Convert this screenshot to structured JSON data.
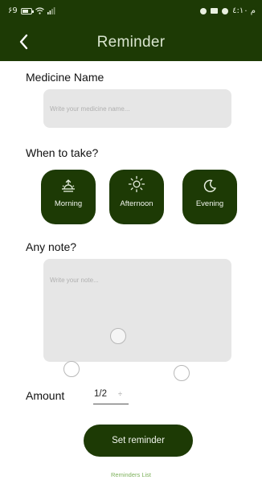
{
  "status_bar": {
    "left_text": "۶9",
    "right_text": "م ٤:١٠",
    "icons": [
      "battery-icon",
      "wifi-icon",
      "signal-icon",
      "whatsapp-icon",
      "camera-icon",
      "whatsapp-icon"
    ]
  },
  "header": {
    "title": "Reminder",
    "back_icon": "chevron-left-icon"
  },
  "medicine": {
    "label": "Medicine Name",
    "placeholder": "Write your medicine name..."
  },
  "when": {
    "label": "When to take?",
    "options": [
      {
        "label": "Morning",
        "icon": "sunrise-icon"
      },
      {
        "label": "Afternoon",
        "icon": "sun-icon"
      },
      {
        "label": "Evening",
        "icon": "moon-icon"
      }
    ]
  },
  "note": {
    "label": "Any note?",
    "placeholder": "Write your note..."
  },
  "amount": {
    "label": "Amount",
    "value": "1/2",
    "caret": "÷"
  },
  "actions": {
    "set_reminder": "Set reminder",
    "reminders_list": "Reminders List"
  },
  "colors": {
    "primary": "#1d3a05",
    "field_bg": "#e6e6e6",
    "link": "#7cb05a"
  }
}
